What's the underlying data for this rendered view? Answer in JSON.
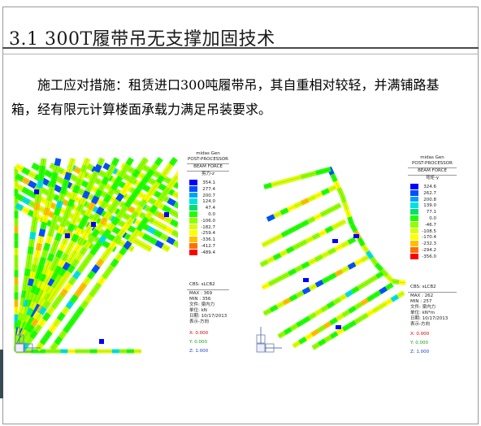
{
  "title": "3.1 300T履带吊无支撑加固技术",
  "body": "施工应对措施：租赁进口300吨履带吊，其自重相对较轻，并满铺路基箱，经有限元计算楼面承载力满足吊装要求。",
  "figures": [
    {
      "legend": {
        "brand": "midas Gen",
        "processor": "POST-PROCESSOR",
        "type": "BEAM FORCE",
        "component": "剪力-z",
        "ticks": [
          "354.1",
          "277.4",
          "200.7",
          "124.0",
          "47.4",
          "0.0",
          "-106.0",
          "-182.7",
          "-259.4",
          "-336.1",
          "-412.7",
          "-489.4"
        ],
        "cbs": "CBS: sLCB2",
        "max": "MAX : 369",
        "min": "MIN : 356",
        "file": "文件: 梁内力",
        "unit": "单位: kN",
        "date": "日期: 10/17/2013",
        "view": "表示-方向",
        "x": "X: 0.000",
        "y": "Y: 0.000",
        "z": "Z: 1.000"
      }
    },
    {
      "legend": {
        "brand": "midas Gen",
        "processor": "POST-PROCESSOR",
        "type": "BEAM FORCE",
        "component": "弯矩-y",
        "ticks": [
          "324.6",
          "262.7",
          "200.8",
          "139.0",
          "77.1",
          "0.0",
          "-46.7",
          "-108.5",
          "-170.4",
          "-232.3",
          "-294.2",
          "-356.0"
        ],
        "cbs": "CBS: sLCB2",
        "max": "MAX : 262",
        "min": "MIN : 257",
        "file": "文件: 梁内力",
        "unit": "单位: kN*m",
        "date": "日期: 10/17/2013",
        "view": "表示-方向",
        "x": "X: 0.000",
        "y": "Y: 0.000",
        "z": "Z: 1.000"
      }
    }
  ],
  "palette": [
    "#0000ff",
    "#0050ff",
    "#00a0ff",
    "#00e0e0",
    "#00e070",
    "#20ff00",
    "#90ff00",
    "#d8ff00",
    "#ffff00",
    "#ffc000",
    "#ff7000",
    "#ff0000"
  ]
}
